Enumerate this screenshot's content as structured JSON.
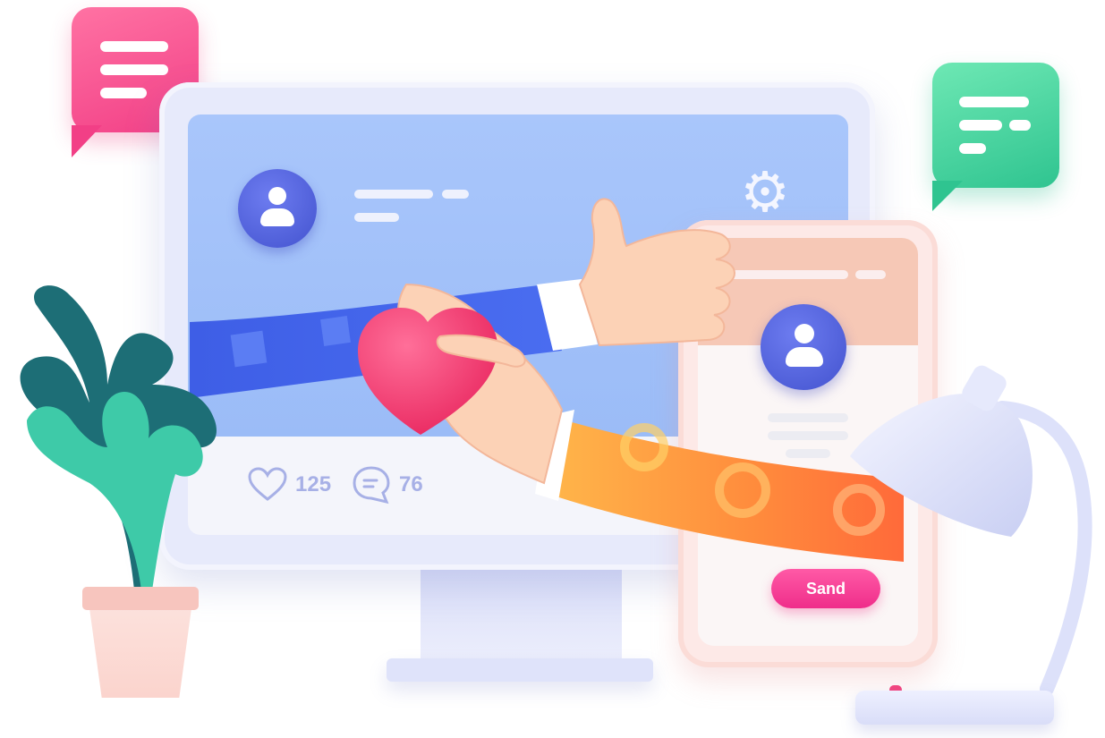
{
  "post": {
    "likes": "125",
    "comments": "76"
  },
  "phone": {
    "button_label": "Sand"
  },
  "icons": {
    "settings": "gear-icon",
    "like": "heart-icon",
    "comment": "comment-bubble-icon",
    "user": "user-avatar-icon"
  },
  "colors": {
    "screen_blue": "#9bbcf7",
    "avatar_blue": "#4353cf",
    "bubble_pink": "#f23f86",
    "bubble_green": "#2fc490",
    "phone_pink": "#fde9e7",
    "button_pink": "#ef2d8a"
  }
}
